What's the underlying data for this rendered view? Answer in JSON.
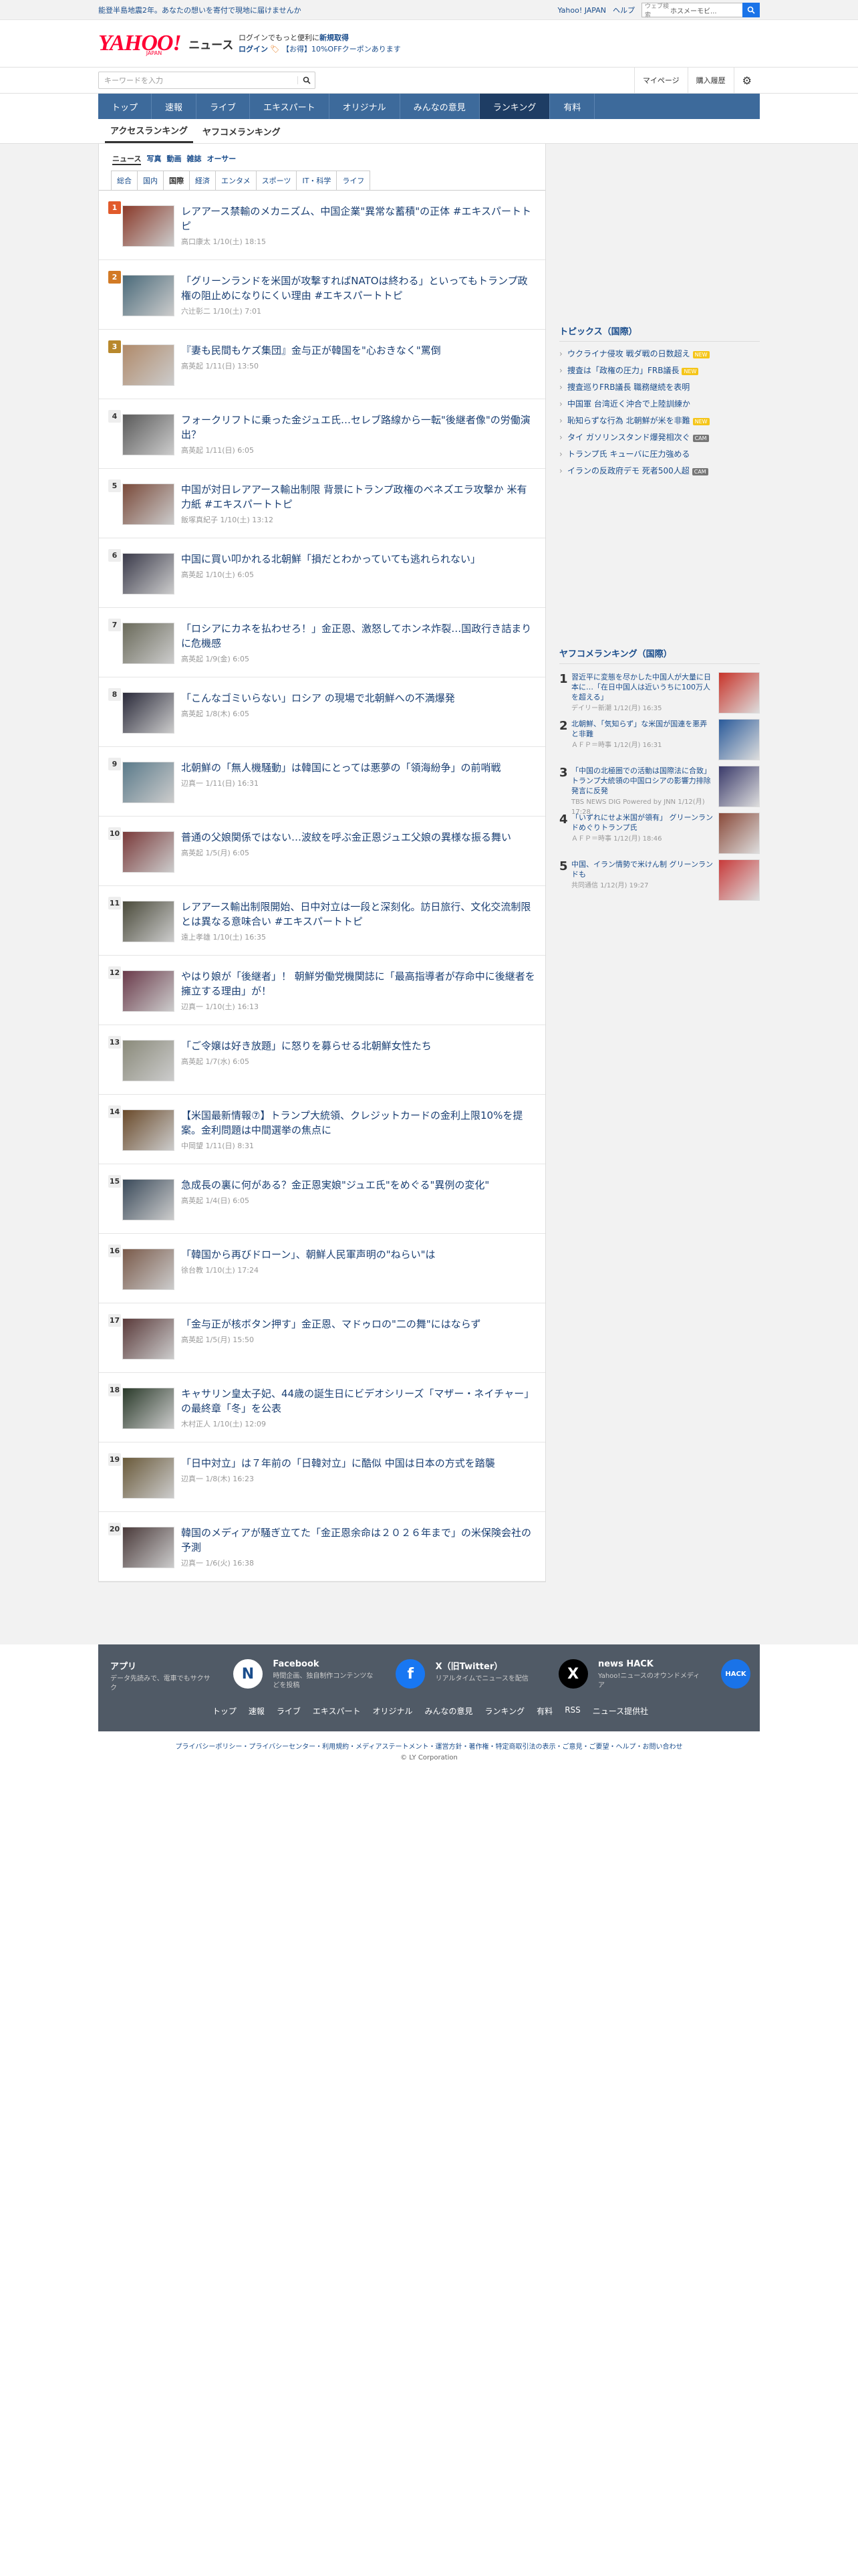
{
  "topbar": {
    "notice": "能登半島地震2年。あなたの想いを寄付で現地に届けませんか",
    "links": [
      "Yahoo! JAPAN",
      "ヘルプ"
    ],
    "search_label": "ウェブ検索",
    "search_value": "ホスメーモビ..."
  },
  "header": {
    "logo": "YAHOO!",
    "logo_sub": "JAPAN",
    "service": "ニュース",
    "promo_line1_pre": "ログインでもっと便利に",
    "promo_line1_link": "新規取得",
    "promo_login": "ログイン",
    "promo_line2": "【お得】10%OFFクーポンあります"
  },
  "search": {
    "placeholder": "キーワードを入力",
    "mypage": "マイページ",
    "history": "購入履歴"
  },
  "nav": [
    "トップ",
    "速報",
    "ライブ",
    "エキスパート",
    "オリジナル",
    "みんなの意見",
    "ランキング",
    "有料"
  ],
  "subtabs": [
    "アクセスランキング",
    "ヤフコメランキング"
  ],
  "cats1": [
    "ニュース",
    "写真",
    "動画",
    "雑誌",
    "オーサー"
  ],
  "cats2": [
    "総合",
    "国内",
    "国際",
    "経済",
    "エンタメ",
    "スポーツ",
    "IT・科学",
    "ライフ"
  ],
  "items": [
    {
      "rank": "1",
      "title": "レアアース禁輸のメカニズム、中国企業\"異常な蓄積\"の正体 #エキスパートトピ",
      "meta": "高口康太 1/10(土) 18:15"
    },
    {
      "rank": "2",
      "title": "「グリーンランドを米国が攻撃すればNATOは終わる」といってもトランプ政権の阻止めになりにくい理由 #エキスパートトピ",
      "meta": "六辻彰二 1/10(土) 7:01"
    },
    {
      "rank": "3",
      "title": "『妻も民間もケズ集団』金与正が韓国を\"心おきなく\"罵倒",
      "meta": "高英起 1/11(日) 13:50"
    },
    {
      "rank": "4",
      "title": "フォークリフトに乗った金ジュエ氏…セレブ路線から一転\"後継者像\"の労働演出？",
      "meta": "高英起 1/11(日) 6:05"
    },
    {
      "rank": "5",
      "title": "中国が対日レアアース輸出制限 背景にトランプ政権のベネズエラ攻撃か 米有力紙 #エキスパートトピ",
      "meta": "飯塚真紀子 1/10(土) 13:12"
    },
    {
      "rank": "6",
      "title": "中国に買い叩かれる北朝鮮「損だとわかっていても逃れられない」",
      "meta": "高英起 1/10(土) 6:05"
    },
    {
      "rank": "7",
      "title": "「ロシアにカネを払わせろ！」金正恩、激怒してホンネ炸裂…国政行き詰まりに危機感",
      "meta": "高英起 1/9(金) 6:05"
    },
    {
      "rank": "8",
      "title": "「こんなゴミいらない」ロシア の現場で北朝鮮への不満爆発",
      "meta": "高英起 1/8(木) 6:05"
    },
    {
      "rank": "9",
      "title": "北朝鮮の「無人機騒動」は韓国にとっては悪夢の「領海紛争」の前哨戦",
      "meta": "辺真一 1/11(日) 16:31"
    },
    {
      "rank": "10",
      "title": "普通の父娘関係ではない…波紋を呼ぶ金正恩ジュエ父娘の異様な振る舞い",
      "meta": "高英起 1/5(月) 6:05"
    },
    {
      "rank": "11",
      "title": "レアアース輸出制限開始、日中対立は一段と深刻化。訪日旅行、文化交流制限とは異なる意味合い #エキスパートトピ",
      "meta": "遠上孝雄 1/10(土) 16:35"
    },
    {
      "rank": "12",
      "title": "やはり娘が「後継者」！ 朝鮮労働党機関誌に「最高指導者が存命中に後継者を擁立する理由」が！",
      "meta": "辺真一 1/10(土) 16:13"
    },
    {
      "rank": "13",
      "title": "「ご令嬢は好き放題」に怒りを募らせる北朝鮮女性たち",
      "meta": "高英起 1/7(水) 6:05"
    },
    {
      "rank": "14",
      "title": "【米国最新情報⑦】トランプ大統領、クレジットカードの金利上限10%を提案。金利問題は中間選挙の焦点に",
      "meta": "中岡望 1/11(日) 8:31"
    },
    {
      "rank": "15",
      "title": "急成長の裏に何がある？金正恩実娘\"ジュエ氏\"をめぐる\"異例の変化\"",
      "meta": "高英起 1/4(日) 6:05"
    },
    {
      "rank": "16",
      "title": "「韓国から再びドローン」、朝鮮人民軍声明の\"ねらい\"は",
      "meta": "徐台教 1/10(土) 17:24"
    },
    {
      "rank": "17",
      "title": "「金与正が核ボタン押す」金正恩、マドゥロの\"二の舞\"にはならず",
      "meta": "高英起 1/5(月) 15:50"
    },
    {
      "rank": "18",
      "title": "キャサリン皇太子妃、44歳の誕生日にビデオシリーズ「マザー・ネイチャー」の最終章「冬」を公表",
      "meta": "木村正人 1/10(土) 12:09"
    },
    {
      "rank": "19",
      "title": "「日中対立」は７年前の「日韓対立」に酷似 中国は日本の方式を踏襲",
      "meta": "辺真一 1/8(木) 16:23"
    },
    {
      "rank": "20",
      "title": "韓国のメディアが騒ぎ立てた「金正恩余命は２０２６年まで」の米保険会社の予測",
      "meta": "辺真一 1/6(火) 16:38"
    }
  ],
  "topics": {
    "heading": "トピックス（国際）",
    "items": [
      {
        "text": "ウクライナ侵攻 戦ダ戦の日数超え",
        "badge": "NEW"
      },
      {
        "text": "捜査は「政権の圧力」FRB議長",
        "badge": "NEW"
      },
      {
        "text": "捜査巡りFRB議長 職務継続を表明",
        "badge": ""
      },
      {
        "text": "中国軍 台湾近く沖合で上陸訓練か",
        "badge": ""
      },
      {
        "text": "恥知らずな行為 北朝鮮が米を非難",
        "badge": "NEW"
      },
      {
        "text": "タイ ガソリンスタンド爆発相次ぐ",
        "badge": "CAM"
      },
      {
        "text": "トランプ氏 キューバに圧力強める",
        "badge": ""
      },
      {
        "text": "イランの反政府デモ 死者500人超",
        "badge": "CAM"
      }
    ]
  },
  "yahcom": {
    "heading": "ヤフコメランキング（国際）",
    "items": [
      {
        "rank": "1",
        "title": "習近平に変態を尽かした中国人が大量に日本に…「在日中国人は近いうちに100万人を超える」",
        "meta": "デイリー新潮 1/12(月) 16:35"
      },
      {
        "rank": "2",
        "title": "北朝鮮、「気知らず」な米国が国連を悪弄と非難",
        "meta": "ＡＦＰ＝時事 1/12(月) 16:31"
      },
      {
        "rank": "3",
        "title": "「中国の北極圏での活動は国際法に合致」 トランプ大統領の中国ロシアの影響力排除発言に反発",
        "meta": "TBS NEWS DIG Powered by JNN 1/12(月) 17:28"
      },
      {
        "rank": "4",
        "title": "「いずれにせよ米国が領有」 グリーンランドめぐりトランプ氏",
        "meta": "ＡＦＰ＝時事 1/12(月) 18:46"
      },
      {
        "rank": "5",
        "title": "中国、イラン情勢で米けん制 グリーンランドも",
        "meta": "共同通信 1/12(月) 19:27"
      }
    ]
  },
  "footer": {
    "cards": [
      {
        "h": "アプリ",
        "d": "データ先読みで、電車でもサクサク",
        "icon": "N"
      },
      {
        "h": "Facebook",
        "d": "時間企画、独自制作コンテンツなどを投稿",
        "icon": "f"
      },
      {
        "h": "X（旧Twitter）",
        "d": "リアルタイムでニュースを配信",
        "icon": "X"
      },
      {
        "h": "news HACK",
        "d": "Yahoo!ニュースのオウンドメディア",
        "icon": "HACK"
      }
    ],
    "links": [
      "トップ",
      "速報",
      "ライブ",
      "エキスパート",
      "オリジナル",
      "みんなの意見",
      "ランキング",
      "有料",
      "RSS",
      "ニュース提供社"
    ],
    "legal": "プライバシーポリシー・プライバシーセンター・利用規約・メディアステートメント・運営方針・著作権・特定商取引法の表示・ご意見・ご要望・ヘルプ・お問い合わせ",
    "copy": "© LY Corporation"
  },
  "colors": {
    "accent": "#3d6a9b",
    "link": "#1a4d8c",
    "brand": "#ff0033"
  }
}
